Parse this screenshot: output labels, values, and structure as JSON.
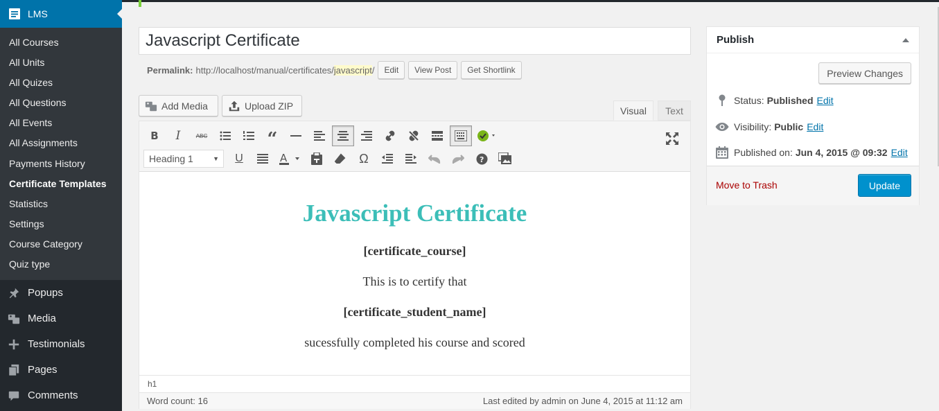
{
  "sidebar": {
    "header": "LMS",
    "submenu": [
      "All Courses",
      "All Units",
      "All Quizes",
      "All Questions",
      "All Events",
      "All Assignments",
      "Payments History",
      "Certificate Templates",
      "Statistics",
      "Settings",
      "Course Category",
      "Quiz type"
    ],
    "current": "Certificate Templates",
    "menu": [
      {
        "label": "Popups",
        "icon": "pin-icon"
      },
      {
        "label": "Media",
        "icon": "media-icon"
      },
      {
        "label": "Testimonials",
        "icon": "plus-icon"
      },
      {
        "label": "Pages",
        "icon": "pages-icon"
      },
      {
        "label": "Comments",
        "icon": "comment-icon"
      }
    ]
  },
  "post": {
    "title": "Javascript Certificate",
    "permalink_label": "Permalink:",
    "permalink_base": "http://localhost/manual/certificates/",
    "permalink_slug": "javascript",
    "permalink_tail": "/",
    "edit_label": "Edit",
    "view_label": "View Post",
    "shortlink_label": "Get Shortlink"
  },
  "media": {
    "add_media": "Add Media",
    "upload_zip": "Upload ZIP"
  },
  "tabs": {
    "visual": "Visual",
    "text": "Text"
  },
  "toolbar": {
    "format_value": "Heading 1"
  },
  "content": {
    "heading": "Javascript Certificate",
    "line1": "[certificate_course]",
    "line2": "This is to certify that",
    "line3": "[certificate_student_name]",
    "line4": "sucessfully completed his course and scored"
  },
  "statusbar": {
    "path": "h1",
    "word_count": "Word count: 16",
    "last_edited": "Last edited by admin on June 4, 2015 at 11:12 am"
  },
  "publish": {
    "title": "Publish",
    "preview": "Preview Changes",
    "status_label": "Status:",
    "status_value": "Published",
    "visibility_label": "Visibility:",
    "visibility_value": "Public",
    "published_label": "Published on:",
    "published_value": "Jun 4, 2015 @ 09:32",
    "edit": "Edit",
    "trash": "Move to Trash",
    "update": "Update"
  },
  "colors": {
    "sidebar_bg": "#23282d",
    "accent": "#0073aa",
    "heading_color": "#3cbeb8",
    "update_button": "#0091cd",
    "trash_color": "#aa0000"
  }
}
